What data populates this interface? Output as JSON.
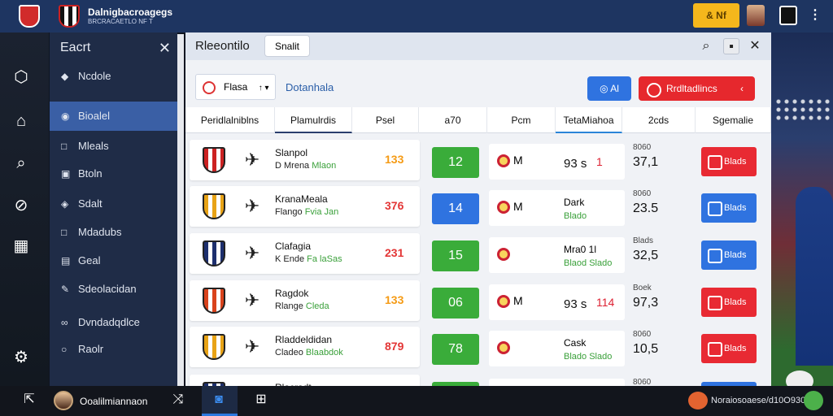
{
  "topbar": {
    "brand_title": "Dalnigbacroagegs",
    "brand_subtitle": "BRCRACAETLO NF T",
    "button_label": "& Nf",
    "menu_icon": "⋮"
  },
  "sidebar": {
    "title": "Eacrt",
    "items": [
      {
        "label": "Ncdole",
        "icon": "tag-icon",
        "glyph": "◆"
      },
      {
        "label": "Bioalel",
        "icon": "globe-icon",
        "glyph": "◉"
      },
      {
        "label": "Mleals",
        "icon": "square-icon",
        "glyph": "□"
      },
      {
        "label": "Btoln",
        "icon": "image-icon",
        "glyph": "▣"
      },
      {
        "label": "Sdalt",
        "icon": "diamond-icon",
        "glyph": "◈"
      },
      {
        "label": "Mdadubs",
        "icon": "square-icon",
        "glyph": "□"
      },
      {
        "label": "Geal",
        "icon": "layer-icon",
        "glyph": "▤"
      },
      {
        "label": "Sdeolacidan",
        "icon": "edit-icon",
        "glyph": "✎"
      },
      {
        "label": "Dvndadqdlce",
        "icon": "link-icon",
        "glyph": "∞"
      },
      {
        "label": "Raolr",
        "icon": "circle-icon",
        "glyph": "○"
      }
    ]
  },
  "rail": {
    "icons": [
      {
        "name": "cube-icon",
        "glyph": "⬡"
      },
      {
        "name": "home-icon",
        "glyph": "⌂"
      },
      {
        "name": "search-icon",
        "glyph": "⌕"
      },
      {
        "name": "tag-icon",
        "glyph": "⊘"
      },
      {
        "name": "table-icon",
        "glyph": "▦"
      },
      {
        "name": "settings-icon",
        "glyph": "⚙"
      }
    ]
  },
  "main": {
    "title": "Rleeontilo",
    "header_button": "Snalit",
    "filter_value": "Flasa",
    "filter_caret": "↑ ▾",
    "filter_label": "Dotanhala",
    "blue_button": "Al",
    "red_button": "Rrdltadlincs",
    "columns": [
      "Peridlalniblns",
      "Plamulrdis",
      "Psel",
      "a70",
      "Pcm",
      "TetaMiahoa",
      "2cds",
      "Sgemalie"
    ],
    "rows": [
      {
        "team": "Slanpol",
        "sub_a": "D Mrena",
        "sub_b": "Mlaon",
        "score": "133",
        "score_color": "#f59b16",
        "number": "12",
        "number_color": "#3aac3a",
        "stat_mark": "M",
        "stat_value": "93 s",
        "stat_name": "",
        "stat_detail": "",
        "stat_extra": "1",
        "odds_label": "8060",
        "odds_value": "37,1",
        "action_label": "Blads",
        "action_color": "#e82a33",
        "crest": "#c22"
      },
      {
        "team": "KranaMeala",
        "sub_a": "Flango",
        "sub_b": "Fvia Jan",
        "score": "376",
        "score_color": "#e33636",
        "number": "14",
        "number_color": "#2f73e0",
        "stat_mark": "M",
        "stat_value": "",
        "stat_name": "Dark",
        "stat_detail": "Blado",
        "stat_extra": "",
        "odds_label": "8060",
        "odds_value": "23.5",
        "action_label": "Blads",
        "action_color": "#2f73e0",
        "crest": "#e8a316"
      },
      {
        "team": "Clafagia",
        "sub_a": "K Ende",
        "sub_b": "Fa laSas",
        "score": "231",
        "score_color": "#e33636",
        "number": "15",
        "number_color": "#3aac3a",
        "stat_mark": "",
        "stat_value": "",
        "stat_name": "Mra0 1l",
        "stat_detail": "Blaod Slado",
        "stat_extra": "",
        "odds_label": "Blads",
        "odds_value": "32,5",
        "action_label": "Blads",
        "action_color": "#2f73e0",
        "crest": "#1d2f6e"
      },
      {
        "team": "Ragdok",
        "sub_a": "Rlange",
        "sub_b": "Cleda",
        "score": "133",
        "score_color": "#f59b16",
        "number": "06",
        "number_color": "#3aac3a",
        "stat_mark": "M",
        "stat_value": "93 s",
        "stat_name": "",
        "stat_detail": "",
        "stat_extra": "114",
        "odds_label": "Boek",
        "odds_value": "97,3",
        "action_label": "Blads",
        "action_color": "#e82a33",
        "crest": "#d9431c"
      },
      {
        "team": "Rladdeldidan",
        "sub_a": "Cladeo",
        "sub_b": "Blaabdok",
        "score": "879",
        "score_color": "#e33636",
        "number": "78",
        "number_color": "#3aac3a",
        "stat_mark": "",
        "stat_value": "",
        "stat_name": "Cask",
        "stat_detail": "Blado Slado",
        "stat_extra": "",
        "odds_label": "8060",
        "odds_value": "10,5",
        "action_label": "Blads",
        "action_color": "#e82a33",
        "crest": "#e8a316"
      },
      {
        "team": "Rlacradt",
        "sub_a": "",
        "sub_b": "",
        "score": "",
        "score_color": "#e33636",
        "number": "",
        "number_color": "#3aac3a",
        "stat_mark": "",
        "stat_value": "",
        "stat_name": "",
        "stat_detail": "",
        "stat_extra": "",
        "odds_label": "8060",
        "odds_value": "",
        "action_label": "",
        "action_color": "#2f73e0",
        "crest": "#1d2f6e"
      }
    ]
  },
  "footer": {
    "user_name": "Ooalilmiannaon",
    "status": "Noraiosoaese/d10O930"
  }
}
